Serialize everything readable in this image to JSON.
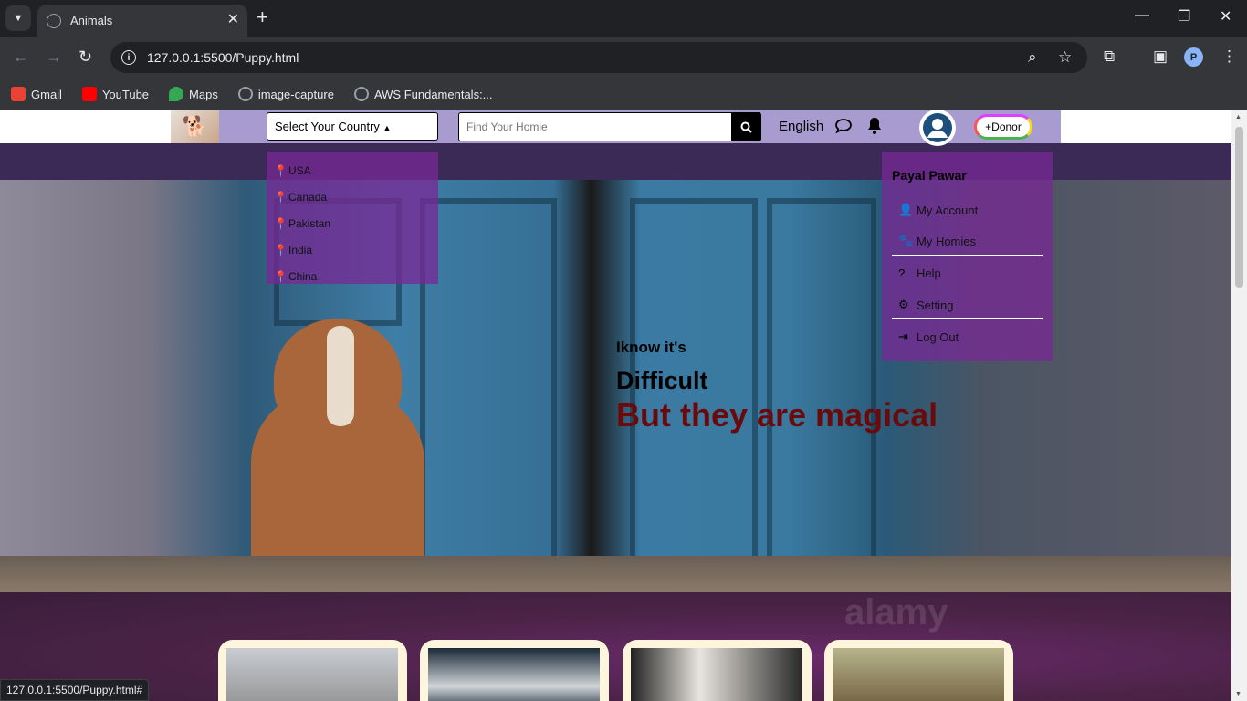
{
  "browser": {
    "tab_title": "Animals",
    "url": "127.0.0.1:5500/Puppy.html",
    "status_url": "127.0.0.1:5500/Puppy.html#",
    "profile_initial": "P",
    "bookmarks": [
      {
        "label": "Gmail",
        "icon": "gmail-icon",
        "color": "#ea4335"
      },
      {
        "label": "YouTube",
        "icon": "youtube-icon",
        "color": "#ff0000"
      },
      {
        "label": "Maps",
        "icon": "maps-icon",
        "color": "#34a853"
      },
      {
        "label": "image-capture",
        "icon": "globe-icon",
        "color": "#9aa0a6"
      },
      {
        "label": "AWS Fundamentals:...",
        "icon": "globe-icon",
        "color": "#9aa0a6"
      }
    ]
  },
  "navbar": {
    "country_select_label": "Select Your Country",
    "search_placeholder": "Find Your Homie",
    "language": "English",
    "donor_label": "+Donor"
  },
  "country_menu": {
    "items": [
      "USA",
      "Canada",
      "Pakistan",
      "India",
      "China"
    ]
  },
  "account_menu": {
    "name": "Payal Pawar",
    "items": [
      {
        "label": "My Account",
        "icon": "user-icon"
      },
      {
        "label": "My Homies",
        "icon": "paw-icon"
      },
      {
        "label": "Help",
        "icon": "question-icon"
      },
      {
        "label": "Setting",
        "icon": "gear-icon"
      },
      {
        "label": "Log Out",
        "icon": "logout-icon"
      }
    ]
  },
  "hero": {
    "line1": "Iknow it's",
    "line2": "Difficult",
    "line3": "But they are magical"
  },
  "watermark": "alamy",
  "colors": {
    "navband": "#a79bd0",
    "menu_bg": "#7a2896",
    "hero_accent": "#6b0a0a"
  }
}
